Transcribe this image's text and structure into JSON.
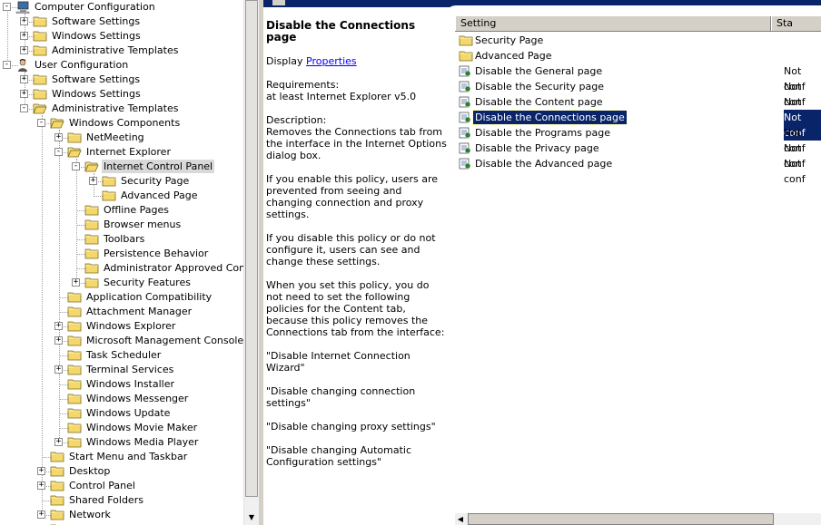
{
  "tree": {
    "items": [
      {
        "label": "Computer Configuration",
        "icon": "computer-icon",
        "expander": "-",
        "selected": false
      },
      {
        "label": "Software Settings",
        "icon": "folder-icon",
        "expander": "+",
        "selected": false
      },
      {
        "label": "Windows Settings",
        "icon": "folder-icon",
        "expander": "+",
        "selected": false
      },
      {
        "label": "Administrative Templates",
        "icon": "folder-icon",
        "expander": "+",
        "selected": false
      },
      {
        "label": "User Configuration",
        "icon": "user-icon",
        "expander": "-",
        "selected": false
      },
      {
        "label": "Software Settings",
        "icon": "folder-icon",
        "expander": "+",
        "selected": false
      },
      {
        "label": "Windows Settings",
        "icon": "folder-icon",
        "expander": "+",
        "selected": false
      },
      {
        "label": "Administrative Templates",
        "icon": "folder-open-icon",
        "expander": "-",
        "selected": false
      },
      {
        "label": "Windows Components",
        "icon": "folder-open-icon",
        "expander": "-",
        "selected": false
      },
      {
        "label": "NetMeeting",
        "icon": "folder-icon",
        "expander": "+",
        "selected": false
      },
      {
        "label": "Internet Explorer",
        "icon": "folder-open-icon",
        "expander": "-",
        "selected": false
      },
      {
        "label": "Internet Control Panel",
        "icon": "folder-open-icon",
        "expander": "-",
        "selected": true
      },
      {
        "label": "Security Page",
        "icon": "folder-icon",
        "expander": "+",
        "selected": false
      },
      {
        "label": "Advanced Page",
        "icon": "folder-icon",
        "expander": "",
        "selected": false
      },
      {
        "label": "Offline Pages",
        "icon": "folder-icon",
        "expander": "",
        "selected": false
      },
      {
        "label": "Browser menus",
        "icon": "folder-icon",
        "expander": "",
        "selected": false
      },
      {
        "label": "Toolbars",
        "icon": "folder-icon",
        "expander": "",
        "selected": false
      },
      {
        "label": "Persistence Behavior",
        "icon": "folder-icon",
        "expander": "",
        "selected": false
      },
      {
        "label": "Administrator Approved Contro",
        "icon": "folder-icon",
        "expander": "",
        "selected": false
      },
      {
        "label": "Security Features",
        "icon": "folder-icon",
        "expander": "+",
        "selected": false
      },
      {
        "label": "Application Compatibility",
        "icon": "folder-icon",
        "expander": "",
        "selected": false
      },
      {
        "label": "Attachment Manager",
        "icon": "folder-icon",
        "expander": "",
        "selected": false
      },
      {
        "label": "Windows Explorer",
        "icon": "folder-icon",
        "expander": "+",
        "selected": false
      },
      {
        "label": "Microsoft Management Console",
        "icon": "folder-icon",
        "expander": "+",
        "selected": false
      },
      {
        "label": "Task Scheduler",
        "icon": "folder-icon",
        "expander": "",
        "selected": false
      },
      {
        "label": "Terminal Services",
        "icon": "folder-icon",
        "expander": "+",
        "selected": false
      },
      {
        "label": "Windows Installer",
        "icon": "folder-icon",
        "expander": "",
        "selected": false
      },
      {
        "label": "Windows Messenger",
        "icon": "folder-icon",
        "expander": "",
        "selected": false
      },
      {
        "label": "Windows Update",
        "icon": "folder-icon",
        "expander": "",
        "selected": false
      },
      {
        "label": "Windows Movie Maker",
        "icon": "folder-icon",
        "expander": "",
        "selected": false
      },
      {
        "label": "Windows Media Player",
        "icon": "folder-icon",
        "expander": "+",
        "selected": false
      },
      {
        "label": "Start Menu and Taskbar",
        "icon": "folder-icon",
        "expander": "",
        "selected": false
      },
      {
        "label": "Desktop",
        "icon": "folder-icon",
        "expander": "+",
        "selected": false
      },
      {
        "label": "Control Panel",
        "icon": "folder-icon",
        "expander": "+",
        "selected": false
      },
      {
        "label": "Shared Folders",
        "icon": "folder-icon",
        "expander": "",
        "selected": false
      },
      {
        "label": "Network",
        "icon": "folder-icon",
        "expander": "+",
        "selected": false
      },
      {
        "label": "",
        "icon": "folder-icon",
        "expander": "+",
        "selected": false
      }
    ]
  },
  "description": {
    "title": "Disable the Connections page",
    "display_prefix": "Display",
    "properties_link": "Properties",
    "requirements_label": "Requirements:",
    "requirements_value": "at least Internet Explorer v5.0",
    "description_label": "Description:",
    "paragraphs": [
      "Removes the Connections tab from the interface in the Internet Options dialog box.",
      "If you enable this policy, users are prevented from seeing and changing connection and proxy settings.",
      "If you disable this policy or do not configure it, users can see and change these settings.",
      "When you set this policy, you do not need to set the following policies for the Content tab, because this policy removes the Connections tab from the interface:",
      "\"Disable Internet Connection Wizard\"",
      "\"Disable changing connection settings\"",
      "\"Disable changing proxy settings\"",
      "\"Disable changing Automatic Configuration settings\""
    ]
  },
  "list": {
    "columns": [
      "Setting",
      "Sta"
    ],
    "rows": [
      {
        "name": "Security Page",
        "state": "",
        "icon": "folder-icon",
        "selected": false
      },
      {
        "name": "Advanced Page",
        "state": "",
        "icon": "folder-icon",
        "selected": false
      },
      {
        "name": "Disable the General page",
        "state": "Not conf",
        "icon": "policy-setting-icon",
        "selected": false
      },
      {
        "name": "Disable the Security page",
        "state": "Not conf",
        "icon": "policy-setting-icon",
        "selected": false
      },
      {
        "name": "Disable the Content page",
        "state": "Not conf",
        "icon": "policy-setting-icon",
        "selected": false
      },
      {
        "name": "Disable the Connections page",
        "state": "Not conf",
        "icon": "policy-setting-icon",
        "selected": true
      },
      {
        "name": "Disable the Programs page",
        "state": "Not conf",
        "icon": "policy-setting-icon",
        "selected": false
      },
      {
        "name": "Disable the Privacy page",
        "state": "Not conf",
        "icon": "policy-setting-icon",
        "selected": false
      },
      {
        "name": "Disable the Advanced page",
        "state": "Not conf",
        "icon": "policy-setting-icon",
        "selected": false
      }
    ]
  },
  "colors": {
    "selection": "#0a246a",
    "tree_selection": "#d9d9d9",
    "link": "#0000ff",
    "folder": "#f5d86c"
  }
}
